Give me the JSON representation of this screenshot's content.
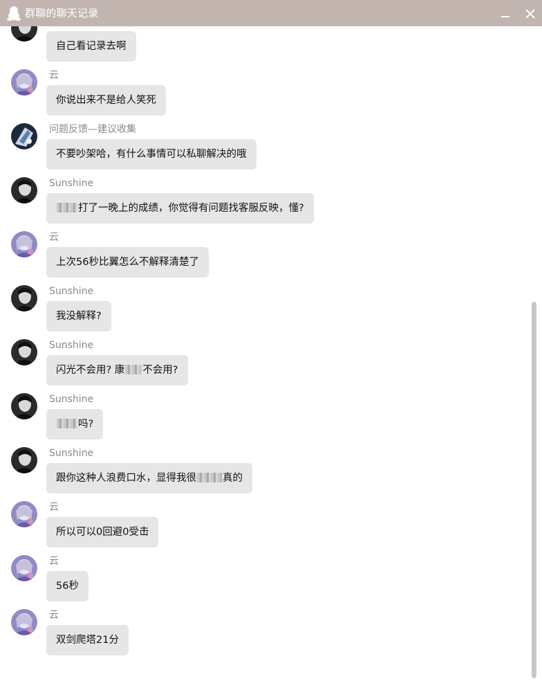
{
  "window": {
    "title": "群聊的聊天记录",
    "title_bar_color": "#c2b5b0",
    "app_icon": "qq-penguin-icon",
    "minimize_icon": "minimize-icon",
    "close_icon": "close-icon"
  },
  "messages": [
    {
      "sender": "",
      "avatar": "dark-portrait-avatar",
      "parts": [
        "自己看记录去啊"
      ]
    },
    {
      "sender": "云",
      "avatar": "anime-avatar",
      "parts": [
        "你说出来不是给人笑死"
      ]
    },
    {
      "sender": "问题反馈—建议收集",
      "avatar": "dark-anime-avatar",
      "parts": [
        "不要吵架哈，有什么事情可以私聊解决的哦"
      ]
    },
    {
      "sender": "Sunshine",
      "avatar": "dark-portrait-avatar",
      "parts": [
        "",
        "打了一晚上的成绩，你觉得有问题找客服反映，懂?"
      ]
    },
    {
      "sender": "云",
      "avatar": "anime-avatar",
      "parts": [
        "上次56秒比翼怎么不解释清楚了"
      ]
    },
    {
      "sender": "Sunshine",
      "avatar": "dark-portrait-avatar",
      "parts": [
        "我没解释?"
      ]
    },
    {
      "sender": "Sunshine",
      "avatar": "dark-portrait-avatar",
      "parts": [
        "闪光不会用? 康",
        "不会用?"
      ]
    },
    {
      "sender": "Sunshine",
      "avatar": "dark-portrait-avatar",
      "parts": [
        "",
        "吗?"
      ]
    },
    {
      "sender": "Sunshine",
      "avatar": "dark-portrait-avatar",
      "parts": [
        "跟你这种人浪费口水，显得我很",
        "真的"
      ]
    },
    {
      "sender": "云",
      "avatar": "anime-avatar",
      "parts": [
        "所以可以0回避0受击"
      ]
    },
    {
      "sender": "云",
      "avatar": "anime-avatar",
      "parts": [
        "56秒"
      ]
    },
    {
      "sender": "云",
      "avatar": "anime-avatar",
      "parts": [
        "双剑爬塔21分"
      ]
    }
  ]
}
